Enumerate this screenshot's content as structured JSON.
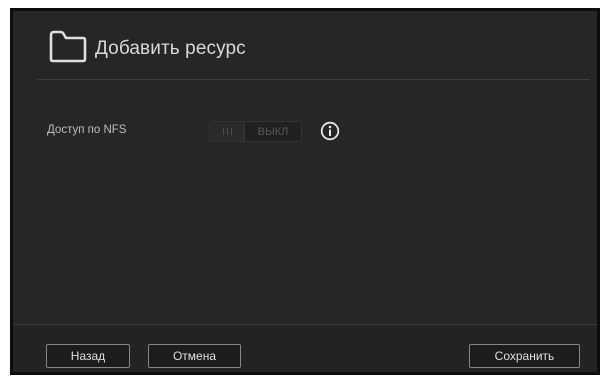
{
  "dialog": {
    "title": "Добавить ресурс",
    "folder_icon": "folder-icon"
  },
  "settings": {
    "nfs": {
      "label": "Доступ по NFS",
      "toggle_on_glyph": "III",
      "toggle_off_label": "ВЫКЛ",
      "state": "off",
      "info_icon": "info-icon"
    }
  },
  "footer": {
    "back_label": "Назад",
    "cancel_label": "Отмена",
    "save_label": "Сохранить"
  },
  "colors": {
    "dialog_background": "#262626",
    "text_primary": "#d9d9d9",
    "button_border": "#888888"
  }
}
